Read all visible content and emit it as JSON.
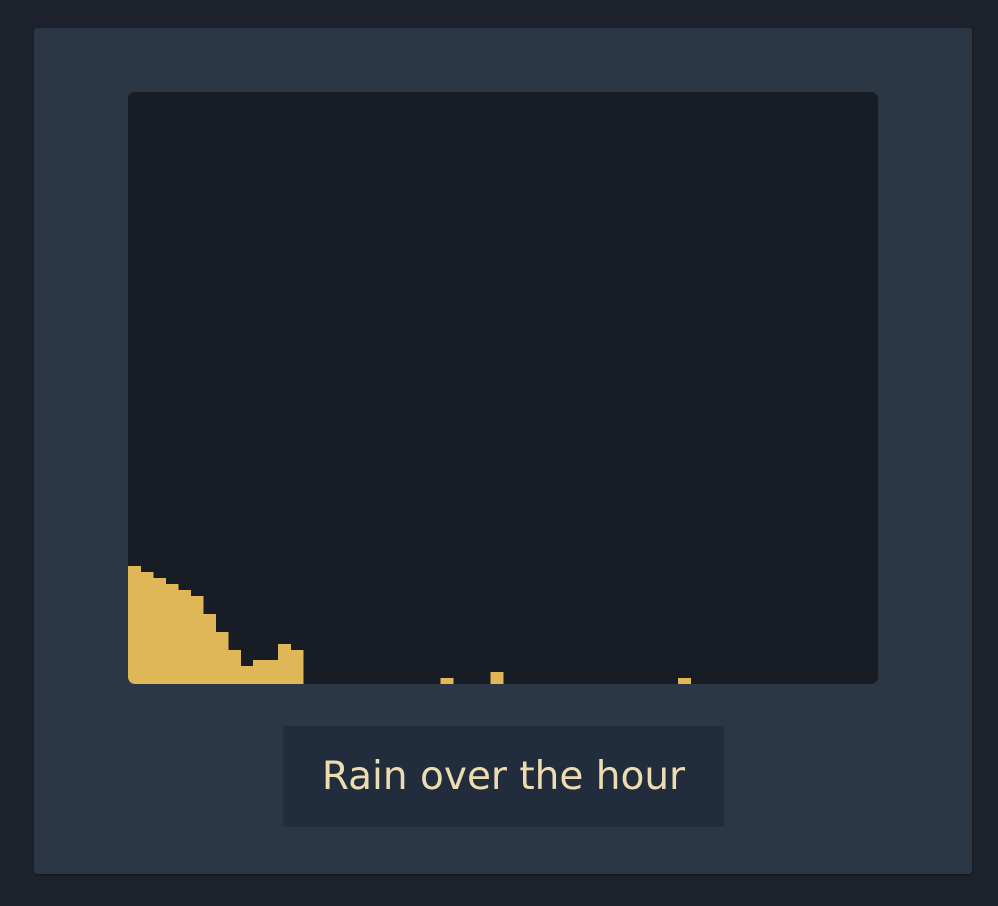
{
  "caption": {
    "label": "Rain over the hour"
  },
  "colors": {
    "page_background": "#1d212b",
    "card": "#2b3744",
    "plot_background": "#171c25",
    "bar_fill": "#dfb757",
    "caption_background": "#212c3c",
    "caption_text": "#eedcb1"
  },
  "chart_data": {
    "type": "bar",
    "title": "",
    "xlabel": "",
    "ylabel": "",
    "grid": false,
    "legend": false,
    "x": [
      1,
      2,
      3,
      4,
      5,
      6,
      7,
      8,
      9,
      10,
      11,
      12,
      13,
      14,
      15,
      16,
      17,
      18,
      19,
      20,
      21,
      22,
      23,
      24,
      25,
      26,
      27,
      28,
      29,
      30,
      31,
      32,
      33,
      34,
      35,
      36,
      37,
      38,
      39,
      40,
      41,
      42,
      43,
      44,
      45,
      46,
      47,
      48,
      49,
      50,
      51,
      52,
      53,
      54,
      55,
      56,
      57,
      58,
      59,
      60
    ],
    "values": [
      19.7,
      18.7,
      17.7,
      16.7,
      15.7,
      14.7,
      11.7,
      8.7,
      5.7,
      3.0,
      4.0,
      4.0,
      6.7,
      5.7,
      0,
      0,
      0,
      0,
      0,
      0,
      0,
      0,
      0,
      0,
      0,
      1,
      0,
      0,
      0,
      2,
      0,
      0,
      0,
      0,
      0,
      0,
      0,
      0,
      0,
      0,
      0,
      0,
      0,
      0,
      1,
      0,
      0,
      0,
      0,
      0,
      0,
      0,
      0,
      0,
      0,
      0,
      0,
      0,
      0,
      0
    ],
    "ylim": [
      0,
      98.7
    ]
  }
}
